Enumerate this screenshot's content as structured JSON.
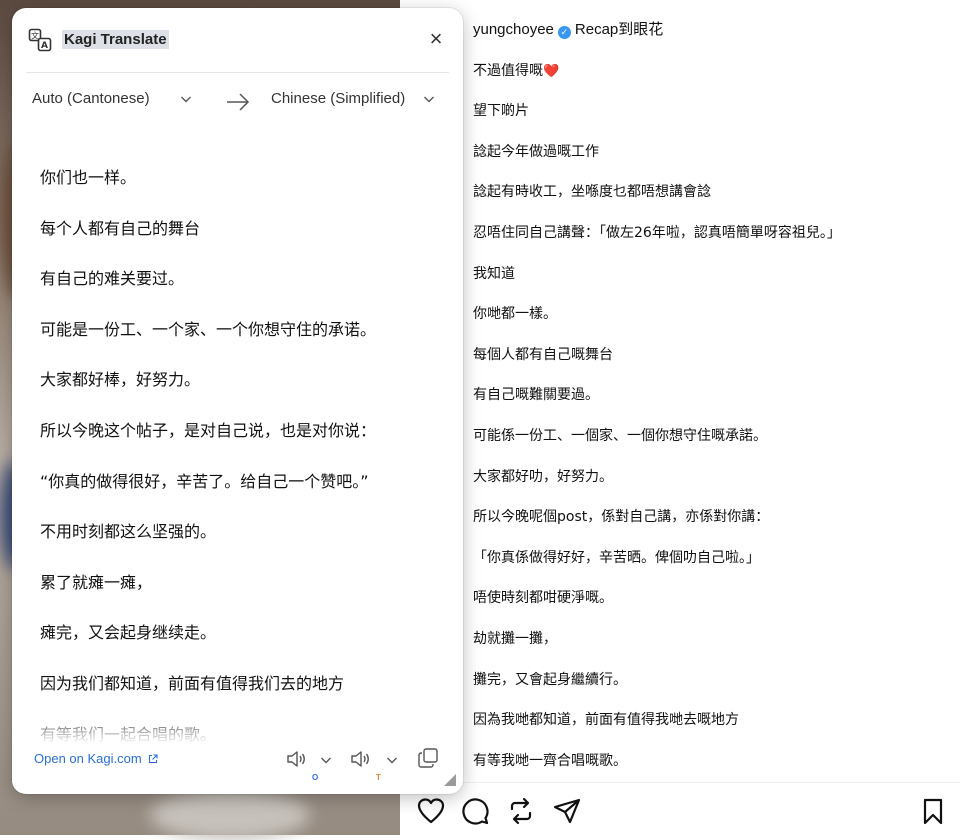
{
  "kagi": {
    "title": "Kagi Translate",
    "source_lang": "Auto (Cantonese)",
    "target_lang": "Chinese (Simplified)",
    "translation_lines": [
      "你们也一样。",
      "每个人都有自己的舞台",
      "有自己的难关要过。",
      "可能是一份工、一个家、一个你想守住的承诺。",
      "大家都好棒，好努力。",
      "所以今晚这个帖子，是对自己说，也是对你说：",
      "“你真的做得很好，辛苦了。给自己一个赞吧。”",
      "不用时刻都这么坚强的。",
      "累了就瘫一瘫，",
      "瘫完，又会起身继续走。",
      "因为我们都知道，前面有值得我们去的地方",
      "有等我们一起合唱的歌。"
    ],
    "open_link": "Open on Kagi.com",
    "source_speaker_tag": "O",
    "target_speaker_tag": "T",
    "accent_blue": "#3a6fd8",
    "accent_orange": "#e58a2b"
  },
  "instagram": {
    "username": "yungchoyee",
    "first_line_text": "Recap到眼花",
    "second_line_text": "不過值得嘅",
    "caption_lines": [
      "望下啲片",
      "諗起今年做過嘅工作",
      "諗起有時收工，坐喺度乜都唔想講會諗",
      "忍唔住同自己講聲：「做左26年啦，認真唔簡單呀容祖兒。」",
      "我知道",
      "你哋都一樣。",
      "每個人都有自己嘅舞台",
      "有自己嘅難關要過。",
      "可能係一份工、一個家、一個你想守住嘅承諾。",
      "大家都好叻，好努力。",
      "所以今晚呢個post，係對自己講，亦係對你講：",
      "「你真係做得好好，辛苦晒。俾個叻自己啦。」",
      "唔使時刻都咁硬淨嘅。",
      "劫就攤一攤，",
      "攤完，又會起身繼續行。",
      "因為我哋都知道，前面有值得我哋去嘅地方",
      "有等我哋一齊合唱嘅歌。"
    ],
    "verified_color": "#3897f0",
    "heart_color": "#e0245e"
  }
}
